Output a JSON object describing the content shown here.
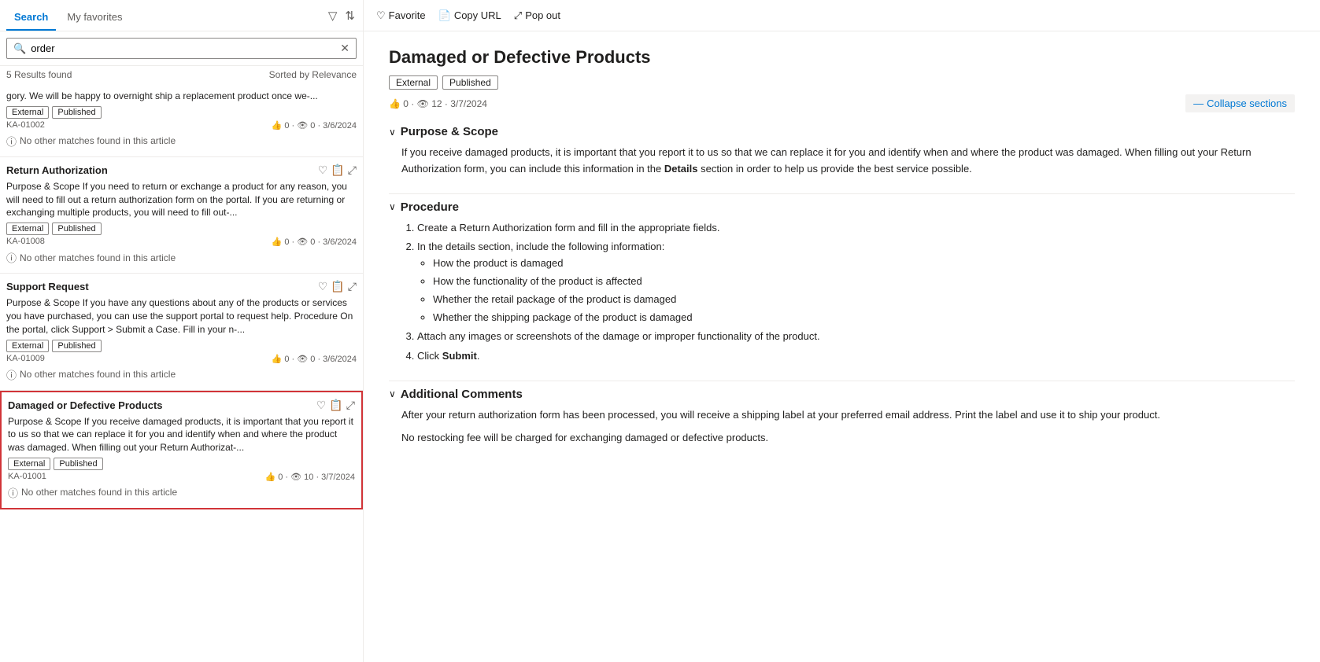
{
  "tabs": {
    "search_label": "Search",
    "favorites_label": "My favorites"
  },
  "search": {
    "value": "order",
    "placeholder": "order",
    "results_count": "5 Results found",
    "sorted_by": "Sorted by Relevance"
  },
  "results": [
    {
      "id": "r1",
      "title": null,
      "snippet": "gory. We will be happy to overnight ship a replacement product once we-...",
      "tags": [
        "External",
        "Published"
      ],
      "ka": "KA-01002",
      "likes": "0",
      "views": "0",
      "date": "3/6/2024",
      "no_match": "No other matches found in this article",
      "selected": false
    },
    {
      "id": "r2",
      "title": "Return Authorization",
      "snippet": "Purpose & Scope If you need to return or exchange a product for any reason, you will need to fill out a return authorization form on the portal. If you are returning or exchanging multiple products, you will need to fill out-...",
      "tags": [
        "External",
        "Published"
      ],
      "ka": "KA-01008",
      "likes": "0",
      "views": "0",
      "date": "3/6/2024",
      "no_match": "No other matches found in this article",
      "selected": false
    },
    {
      "id": "r3",
      "title": "Support Request",
      "snippet": "Purpose & Scope If you have any questions about any of the products or services you have purchased, you can use the support portal to request help. Procedure On the portal, click Support > Submit a Case. Fill in your n-...",
      "tags": [
        "External",
        "Published"
      ],
      "ka": "KA-01009",
      "likes": "0",
      "views": "0",
      "date": "3/6/2024",
      "no_match": "No other matches found in this article",
      "selected": false
    },
    {
      "id": "r4",
      "title": "Damaged or Defective Products",
      "snippet": "Purpose & Scope If you receive damaged products, it is important that you report it to us so that we can replace it for you and identify when and where the product was damaged. When filling out your Return Authorizat-...",
      "tags": [
        "External",
        "Published"
      ],
      "ka": "KA-01001",
      "likes": "0",
      "views": "10",
      "date": "3/7/2024",
      "no_match": "No other matches found in this article",
      "selected": true
    }
  ],
  "article": {
    "title": "Damaged or Defective Products",
    "tags": [
      "External",
      "Published"
    ],
    "likes": "0",
    "views": "12",
    "date": "3/7/2024",
    "collapse_btn": "Collapse sections",
    "toolbar": {
      "favorite": "Favorite",
      "copy_url": "Copy URL",
      "pop_out": "Pop out"
    },
    "sections": [
      {
        "heading": "Purpose & Scope",
        "content_paragraphs": [
          "If you receive damaged products, it is important that you report it to us so that we can replace it for you and identify when and where the product was damaged. When filling out your Return Authorization form, you can include this information in the Details section in order to help us provide the best service possible."
        ],
        "has_bold": [
          "Details"
        ]
      },
      {
        "heading": "Procedure",
        "ordered_list": [
          "Create a Return Authorization form and fill in the appropriate fields.",
          "In the details section, include the following information:"
        ],
        "sub_bullets": [
          "How the product is damaged",
          "How the functionality of the product is affected",
          "Whether the retail package of the product is damaged",
          "Whether the shipping package of the product is damaged"
        ],
        "ordered_list_cont": [
          "Attach any images or screenshots of the damage or improper functionality of the product.",
          "Click Submit."
        ]
      },
      {
        "heading": "Additional Comments",
        "content_paragraphs": [
          "After your return authorization form has been processed, you will receive a shipping label at your preferred email address. Print the label and use it to ship your product.",
          "No restocking fee will be charged for exchanging damaged or defective products."
        ]
      }
    ]
  }
}
